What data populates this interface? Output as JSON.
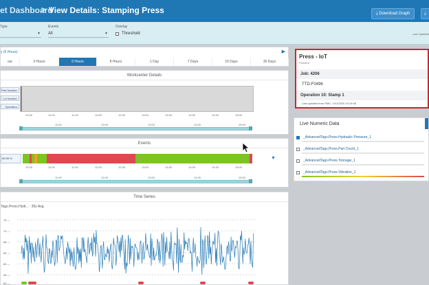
{
  "header": {
    "crumb": "et Dashboard",
    "title": "View Details: Stamping Press",
    "download_graph": "Download Graph"
  },
  "filters": {
    "type_label": "Type",
    "events_label": "Events",
    "events_value": "All",
    "overlay_label": "Overlay",
    "threshold_label": "Threshold",
    "last_saved": "Last Updated"
  },
  "range": {
    "title": "y (5 Hours)",
    "options": [
      "our",
      "3 Hours",
      "5 Hours",
      "8 Hours",
      "1 Day",
      "7 Days",
      "15 Days",
      "30 Days"
    ],
    "active_index": 2
  },
  "workcenter": {
    "title": "Workcenter Details",
    "rows": [
      "Part Number",
      "Lot Number",
      "Operation"
    ],
    "ticks": [
      "10:30",
      "11:00",
      "11:30",
      "12:00",
      "12:30",
      "13:00",
      "13:30",
      "14:00",
      "14:30",
      "15:00"
    ],
    "slider_ticks": [
      "11:00",
      "12:00",
      "13:00",
      "14:00",
      "15:00"
    ]
  },
  "events": {
    "title": "Events",
    "label": "06:35 %",
    "ticks": [
      "10:30",
      "11:00",
      "11:30",
      "12:00",
      "12:30",
      "13:00",
      "13:30",
      "14:00",
      "14:30",
      "15:00"
    ],
    "slider_ticks": [
      "11:00",
      "12:00",
      "13:00",
      "14:00",
      "15:00"
    ],
    "colors": {
      "running": "#7cc41f",
      "down": "#e0474f",
      "idle": "#f0a030"
    }
  },
  "timeseries": {
    "title": "Time Series",
    "subtitle": "Tags.Press.Hydr... : 30s Avg.",
    "y_ticks": [
      "76 —",
      "72 —",
      "68 —",
      "64 —",
      "60 —",
      "56 —",
      "52 —"
    ],
    "line_color": "#1f77b4"
  },
  "asset_card": {
    "title": "Press - IoT",
    "status": "Problem",
    "job": "Job: 4206",
    "part": "TTD-F0496",
    "operation": "Operation 10: Stamp 1",
    "updated": "Last updated from PMC: 10/1/2020 15:19:08",
    "border_color": "#c9262f"
  },
  "live": {
    "title": "Live Numeric Data",
    "items": [
      {
        "name": "_AdvancedTags.Press.Hydraulic Pressure_1",
        "checked": true
      },
      {
        "name": "_AdvancedTags.Press.Part Count_1",
        "checked": false
      },
      {
        "name": "_AdvancedTags.Press.Tonnage_1",
        "checked": false
      },
      {
        "name": "_AdvancedTags.Press.Vibration_1",
        "checked": false
      }
    ]
  }
}
